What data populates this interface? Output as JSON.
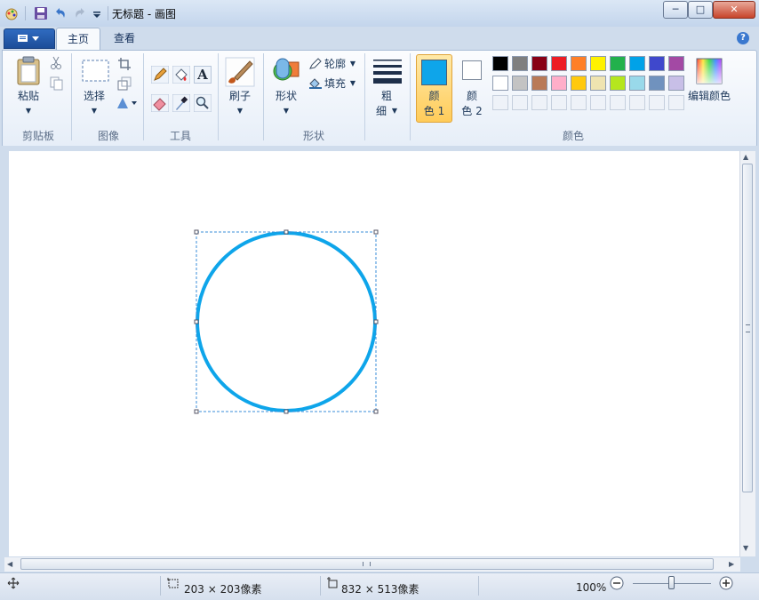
{
  "window": {
    "title": "无标题 - 画图",
    "controls": {
      "minimize": "─",
      "maximize": "□",
      "close": "✕"
    }
  },
  "ribbon": {
    "tabs": [
      {
        "label": "主页",
        "active": true
      },
      {
        "label": "查看",
        "active": false
      }
    ],
    "help_glyph": "?",
    "groups": {
      "clipboard": {
        "label": "剪贴板",
        "paste_label": "粘贴"
      },
      "image": {
        "label": "图像",
        "select_label": "选择"
      },
      "tools": {
        "label": "工具",
        "text_tool_glyph": "A"
      },
      "brushes": {
        "label": "刷子"
      },
      "shapes": {
        "label": "形状",
        "shapes_label": "形状",
        "outline_label": "轮廓",
        "fill_label": "填充"
      },
      "size": {
        "label_line1": "粗",
        "label_line2": "细"
      },
      "colors": {
        "label": "颜色",
        "color1_line1": "颜",
        "color1_line2": "色 1",
        "color2_line1": "颜",
        "color2_line2": "色 2",
        "edit_label": "编辑颜色",
        "color1_value": "#0ea5ea",
        "color2_value": "#ffffff",
        "palette_row1": [
          "#000000",
          "#7f7f7f",
          "#880015",
          "#ed1c24",
          "#ff7f27",
          "#fff200",
          "#22b14c",
          "#00a2e8",
          "#3f48cc",
          "#a349a4"
        ],
        "palette_row2": [
          "#ffffff",
          "#c3c3c3",
          "#b97a57",
          "#ffaec9",
          "#ffc90e",
          "#efe4b0",
          "#b5e61d",
          "#99d9ea",
          "#7092be",
          "#c8bfe7"
        ]
      }
    }
  },
  "canvas": {
    "shape": "circle",
    "stroke_color": "#0ea5ea"
  },
  "statusbar": {
    "selection_size": "203 × 203像素",
    "image_size": "832 × 513像素",
    "zoom": "100%"
  }
}
